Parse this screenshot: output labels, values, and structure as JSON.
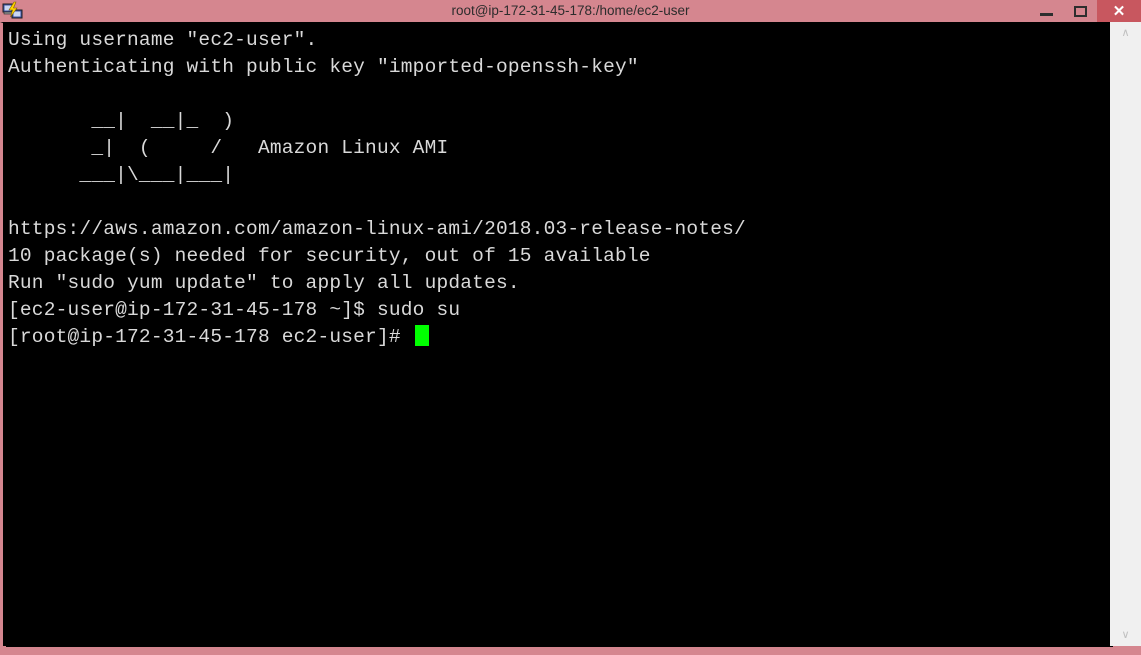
{
  "window": {
    "title": "root@ip-172-31-45-178:/home/ec2-user",
    "app_icon": "putty-icon",
    "titlebar_color": "#d5868f",
    "close_button_color": "#c8575f",
    "controls": {
      "minimize_label": "",
      "maximize_label": "",
      "close_label": "✕"
    }
  },
  "terminal": {
    "background_color": "#000000",
    "foreground_color": "#d9d9d9",
    "cursor_color": "#00ff00",
    "lines": [
      "Using username \"ec2-user\".",
      "Authenticating with public key \"imported-openssh-key\"",
      "",
      "       __|  __|_  )",
      "       _|  (     /   Amazon Linux AMI",
      "      ___|\\___|___|",
      "",
      "https://aws.amazon.com/amazon-linux-ami/2018.03-release-notes/",
      "10 package(s) needed for security, out of 15 available",
      "Run \"sudo yum update\" to apply all updates.",
      "[ec2-user@ip-172-31-45-178 ~]$ sudo su"
    ],
    "prompt": "[root@ip-172-31-45-178 ec2-user]# ",
    "command": ""
  },
  "scrollbar": {
    "up_arrow": "∧",
    "down_arrow": "∨"
  }
}
